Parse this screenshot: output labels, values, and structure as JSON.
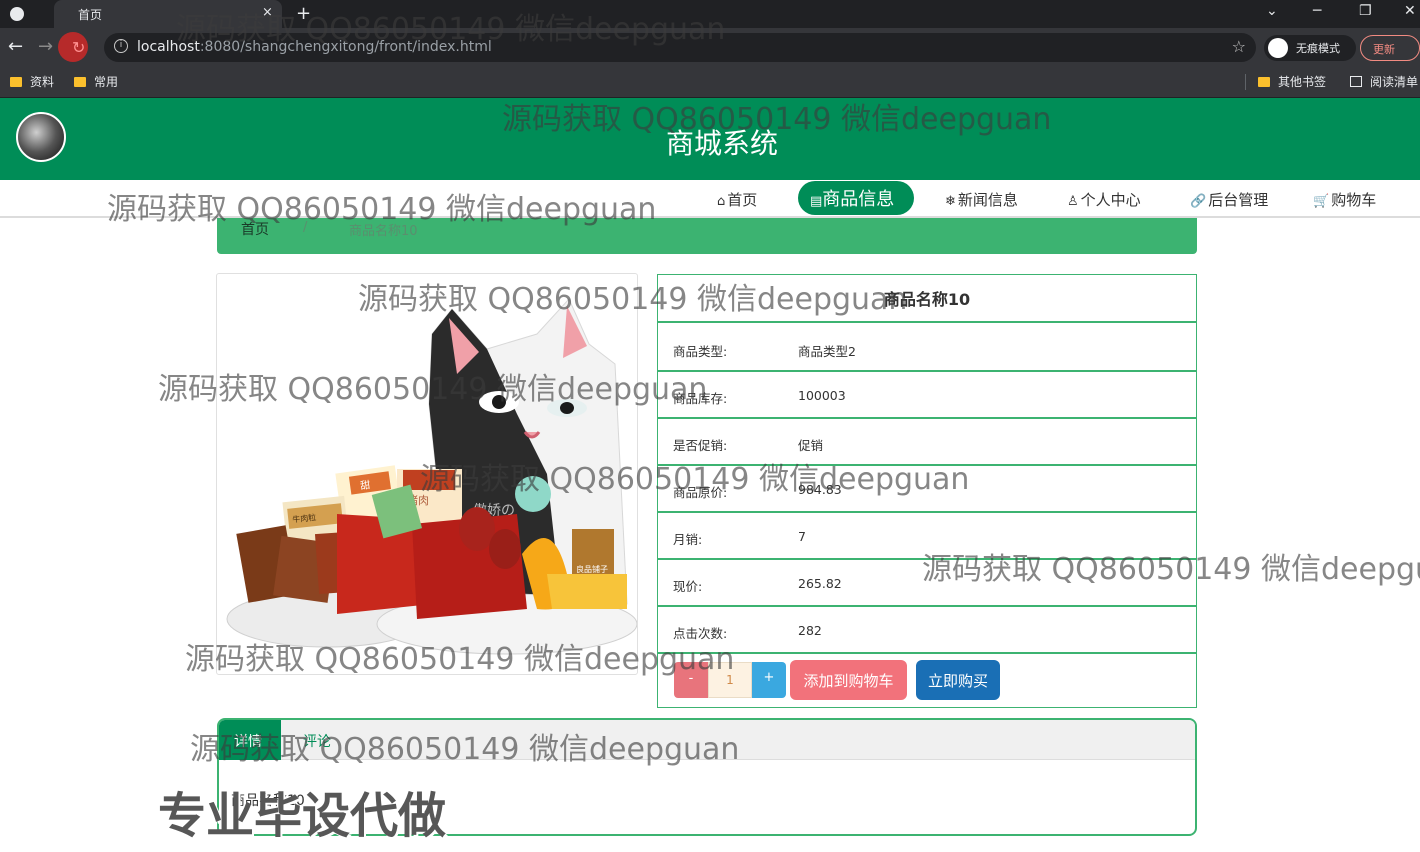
{
  "browser": {
    "tab_title": "首页",
    "close_glyph": "×",
    "new_tab_glyph": "+",
    "url_host": "localhost",
    "url_rest": ":8080/shangchengxitong/front/index.html",
    "incognito_label": "无痕模式",
    "update_label": "更新",
    "window_controls": [
      "⌄",
      "─",
      "❐",
      "✕"
    ],
    "nav_glyphs": {
      "back": "←",
      "forward": "→",
      "reload": "↻"
    },
    "bookmarks_left": [
      "资料",
      "常用"
    ],
    "bookmarks_right": [
      "其他书签",
      "阅读清单"
    ],
    "icons": [
      "back-icon",
      "forward-icon",
      "reload-icon",
      "info-icon",
      "star-icon",
      "folder-icon",
      "reading-list-icon",
      "incognito-icon"
    ]
  },
  "site": {
    "title": "商城系统",
    "nav": [
      {
        "label": "首页",
        "icon": "⌂"
      },
      {
        "label": "商品信息",
        "icon": "▤",
        "active": true
      },
      {
        "label": "新闻信息",
        "icon": "❄"
      },
      {
        "label": "个人中心",
        "icon": "♙"
      },
      {
        "label": "后台管理",
        "icon": "🔗"
      },
      {
        "label": "购物车",
        "icon": "🛒"
      }
    ],
    "breadcrumb": {
      "home": "首页",
      "sep": "/",
      "current": "商品名称10"
    },
    "accent_color": "#008d57"
  },
  "product": {
    "name": "商品名称10",
    "fields": [
      {
        "label": "商品类型:",
        "value": "商品类型2"
      },
      {
        "label": "商品库存:",
        "value": "100003"
      },
      {
        "label": "是否促销:",
        "value": "促销"
      },
      {
        "label": "商品原价:",
        "value": "984.83"
      },
      {
        "label": "月销:",
        "value": "7"
      },
      {
        "label": "现价:",
        "value": "265.82"
      },
      {
        "label": "点击次数:",
        "value": "282"
      }
    ],
    "image_labels": [
      "甜",
      "猪肉",
      "牛肉粒",
      "傲娇の",
      "良品铺子"
    ],
    "quantity": "1",
    "minus_label": "-",
    "plus_label": "+",
    "add_to_cart_label": "添加到购物车",
    "buy_now_label": "立即购买"
  },
  "tabs": {
    "detail_label": "详情",
    "comment_label": "评论",
    "content": "商品名称10"
  },
  "overlay": {
    "watermark": "源码获取 QQ86050149 微信deepguan",
    "watermark_cut": "源码获取 QQ86050149 微信deepgu",
    "promo": "专业毕设代做"
  }
}
